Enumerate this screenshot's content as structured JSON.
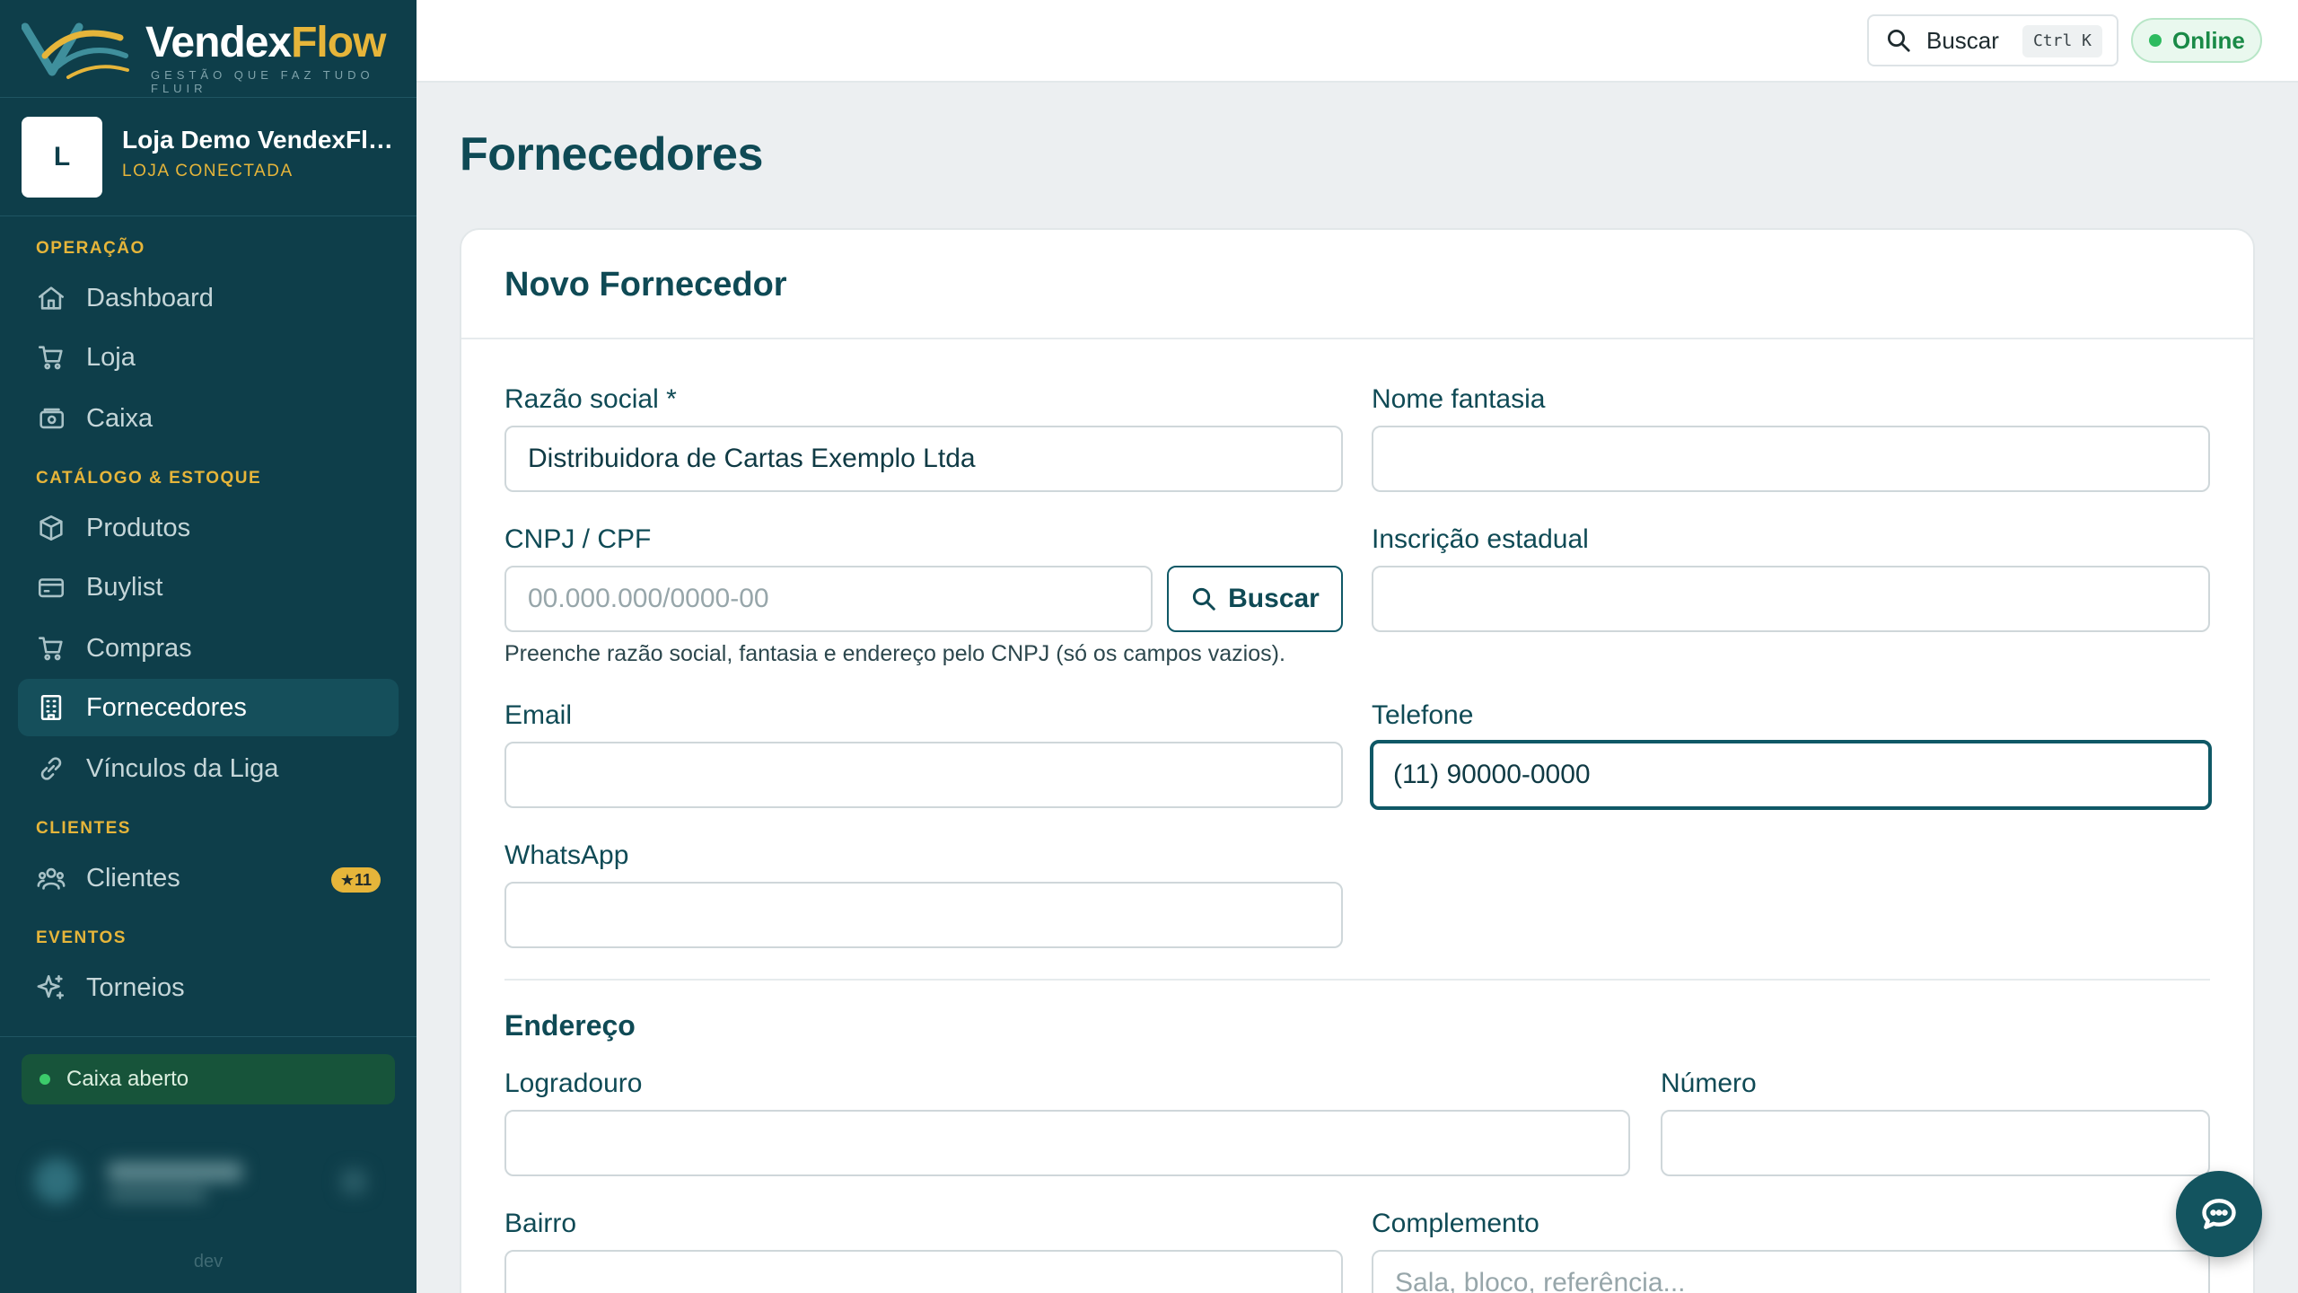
{
  "brand": {
    "name_part1": "Vendex",
    "name_part2": "Flow",
    "tagline": "GESTÃO QUE FAZ TUDO FLUIR",
    "colors": {
      "primary": "#0e3e4a",
      "accent": "#e6b53a"
    }
  },
  "store": {
    "initial": "L",
    "name": "Loja Demo VendexFlow",
    "status": "LOJA CONECTADA"
  },
  "sidebar": {
    "sections": [
      {
        "title": "OPERAÇÃO"
      },
      {
        "title": "CATÁLOGO & ESTOQUE"
      },
      {
        "title": "CLIENTES"
      },
      {
        "title": "EVENTOS"
      }
    ],
    "items": [
      {
        "label": "Dashboard",
        "icon": "home-icon"
      },
      {
        "label": "Loja",
        "icon": "cart-icon"
      },
      {
        "label": "Caixa",
        "icon": "register-icon"
      },
      {
        "label": "Produtos",
        "icon": "box-icon"
      },
      {
        "label": "Buylist",
        "icon": "card-icon"
      },
      {
        "label": "Compras",
        "icon": "cart-icon"
      },
      {
        "label": "Fornecedores",
        "icon": "building-icon",
        "active": true
      },
      {
        "label": "Vínculos da Liga",
        "icon": "link-icon"
      },
      {
        "label": "Clientes",
        "icon": "users-icon",
        "badge": "★11"
      },
      {
        "label": "Torneios",
        "icon": "sparkle-icon"
      }
    ],
    "cash_status": "Caixa aberto",
    "env": "dev"
  },
  "topbar": {
    "search_label": "Buscar",
    "search_shortcut": "Ctrl K",
    "status": "Online"
  },
  "page": {
    "title": "Fornecedores"
  },
  "form": {
    "title": "Novo Fornecedor",
    "razao_social": {
      "label": "Razão social *",
      "value": "Distribuidora de Cartas Exemplo Ltda"
    },
    "nome_fantasia": {
      "label": "Nome fantasia",
      "value": ""
    },
    "cnpj": {
      "label": "CNPJ / CPF",
      "value": "",
      "placeholder": "00.000.000/0000-00"
    },
    "cnpj_button": "Buscar",
    "cnpj_hint": "Preenche razão social, fantasia e endereço pelo CNPJ (só os campos vazios).",
    "inscricao": {
      "label": "Inscrição estadual",
      "value": ""
    },
    "email": {
      "label": "Email",
      "value": ""
    },
    "telefone": {
      "label": "Telefone",
      "value": "(11) 90000-0000"
    },
    "whatsapp": {
      "label": "WhatsApp",
      "value": ""
    },
    "address_section": "Endereço",
    "logradouro": {
      "label": "Logradouro",
      "value": ""
    },
    "numero": {
      "label": "Número",
      "value": ""
    },
    "bairro": {
      "label": "Bairro",
      "value": ""
    },
    "complemento": {
      "label": "Complemento",
      "value": "",
      "placeholder": "Sala, bloco, referência..."
    }
  },
  "chat": {
    "icon": "chat-icon"
  }
}
